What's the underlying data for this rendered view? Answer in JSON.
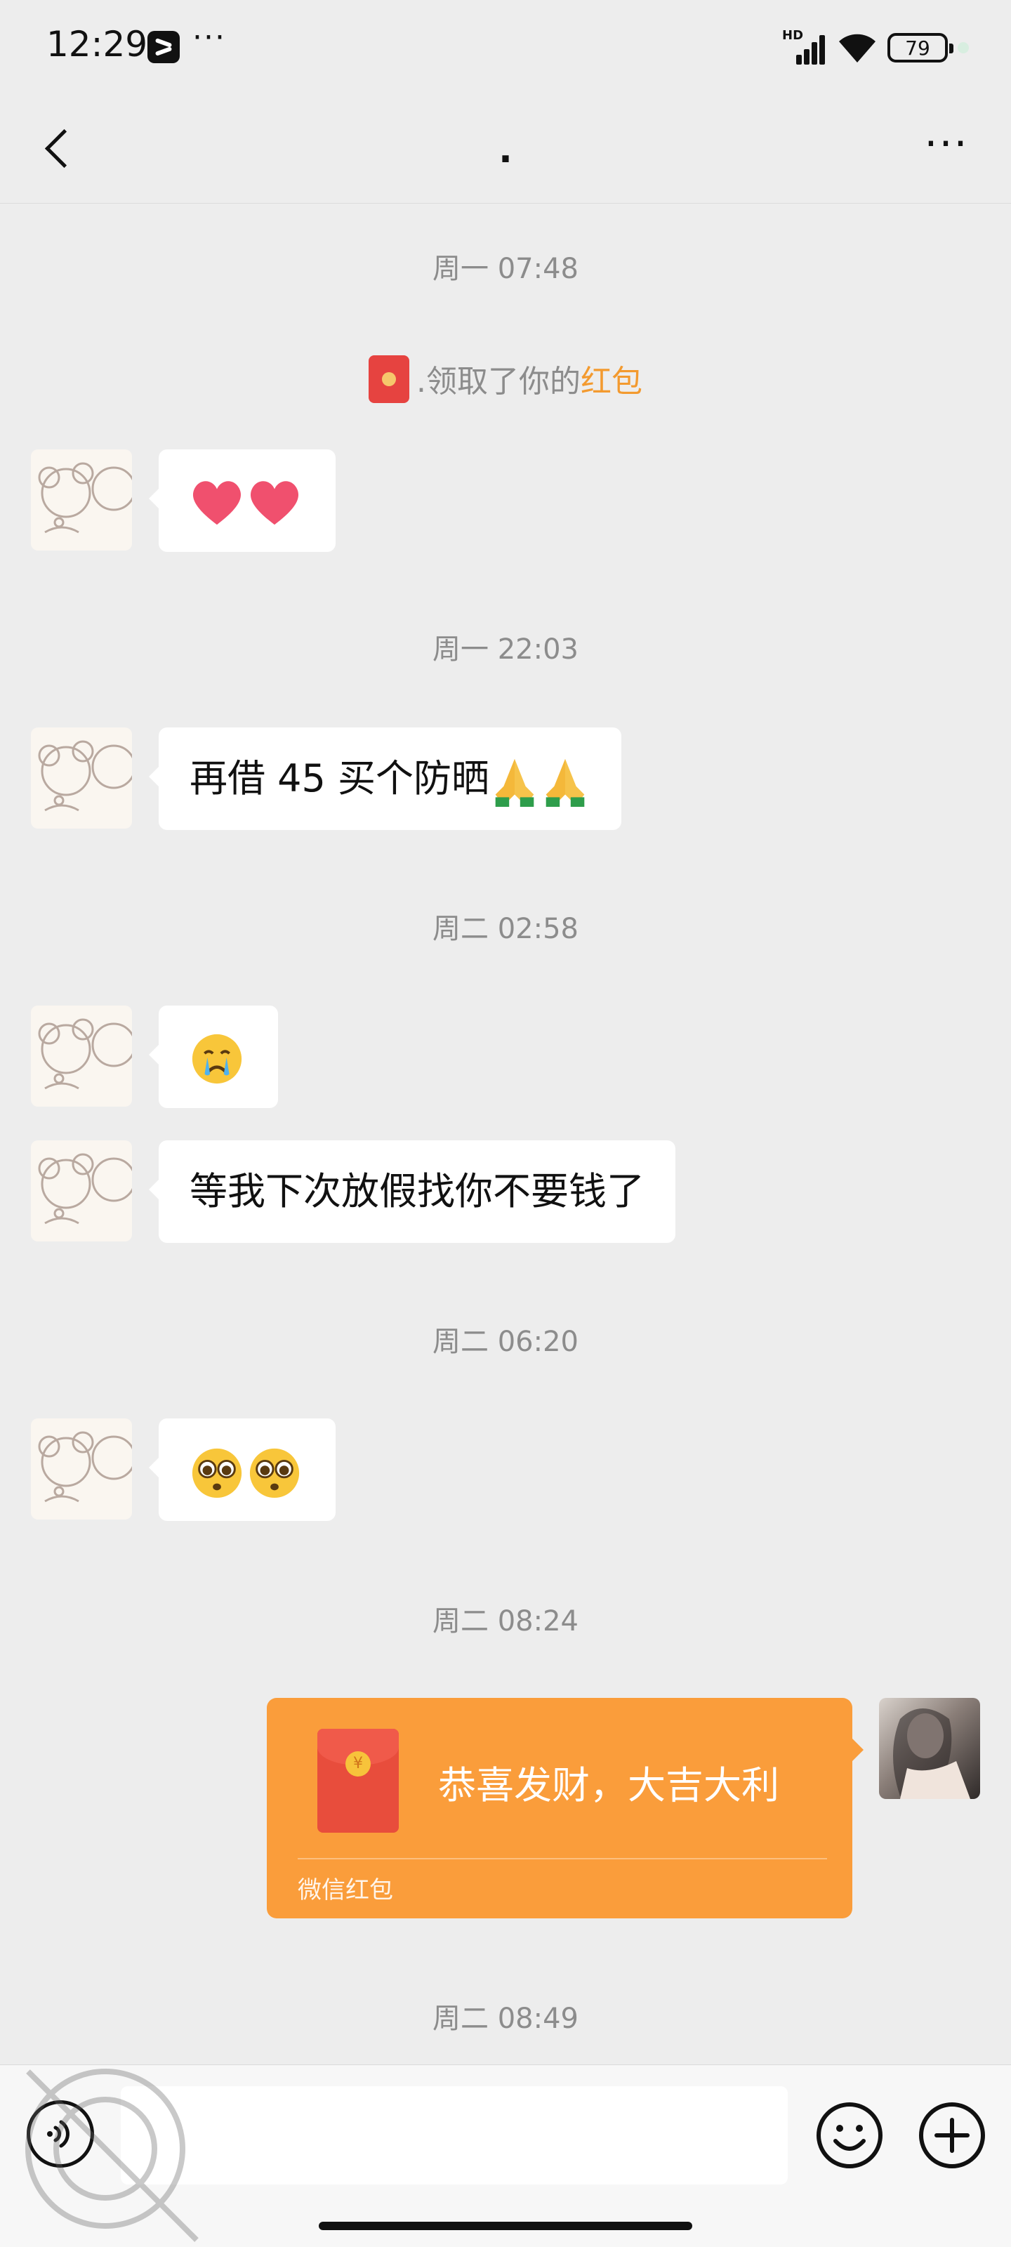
{
  "status_bar": {
    "time": "12:29",
    "more": "···",
    "network": "HD",
    "battery": "79"
  },
  "nav": {
    "title": ".",
    "more": "···"
  },
  "messages": {
    "ts1": "周一 07:48",
    "sys_prefix": ".领取了你的",
    "sys_link": "红包",
    "ts2": "周一 22:03",
    "text1": "再借 45 买个防晒",
    "ts3": "周二 02:58",
    "text2": "等我下次放假找你不要钱了",
    "ts4": "周二 06:20",
    "ts5": "周二 08:24",
    "ts6": "周二 08:49"
  },
  "red_packet": {
    "title": "恭喜发财，大吉大利",
    "label": "微信红包"
  },
  "colors": {
    "background": "#ededed",
    "bubble": "#ffffff",
    "red_packet": "#fa9d3b",
    "link": "#f39a2f"
  }
}
